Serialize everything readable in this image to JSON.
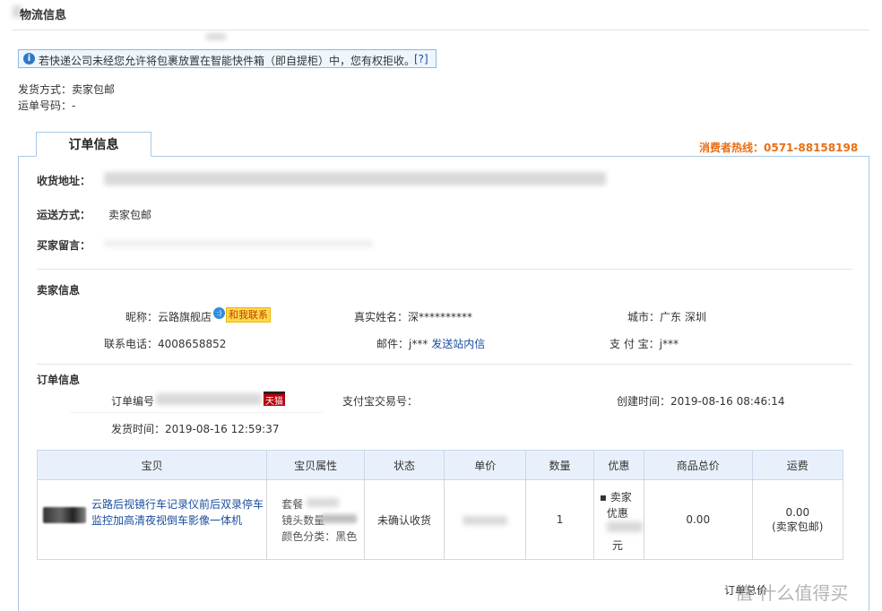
{
  "logistics": {
    "title": "物流信息",
    "notice": "若快递公司未经您允许将包裹放置在智能快件箱（即自提柜）中，您有权拒收。",
    "notice_help": "[?]",
    "ship_method_label": "发货方式：",
    "ship_method_value": "卖家包邮",
    "waybill_label": "运单号码：",
    "waybill_value": "-"
  },
  "tab": {
    "label": "订单信息"
  },
  "hotline": "消费者热线：0571-88158198",
  "receiver": {
    "address_label": "收货地址：",
    "shipping_label": "运送方式：",
    "shipping_value": "卖家包邮",
    "message_label": "买家留言："
  },
  "seller": {
    "section_title": "卖家信息",
    "nickname_label": "昵称：",
    "nickname_value": "云路旗舰店",
    "contact_badge": "和我联系",
    "realname_label": "真实姓名：",
    "realname_value": "深**********",
    "city_label": "城市：",
    "city_value": "广东 深圳",
    "phone_label": "联系电话：",
    "phone_value": "4008658852",
    "email_label": "邮件：",
    "email_value": "j***",
    "email_link": "发送站内信",
    "alipay_label": "支 付 宝：",
    "alipay_value": "j***"
  },
  "order": {
    "section_title": "订单信息",
    "order_no_label": "订单编号",
    "tmall_badge": "天猫",
    "alipay_trade_label": "支付宝交易号：",
    "created_label": "创建时间：",
    "created_value": "2019-08-16 08:46:14",
    "shipped_label": "发货时间：",
    "shipped_value": "2019-08-16 12:59:37"
  },
  "goods_table": {
    "headers": [
      "宝贝",
      "宝贝属性",
      "状态",
      "单价",
      "数量",
      "优惠",
      "商品总价",
      "运费"
    ],
    "row": {
      "title": "云路后视镜行车记录仪前后双录停车监控加高清夜视倒车影像一体机",
      "attr_package": "套餐",
      "attr_lens": "镜头数量",
      "attr_color": "颜色分类：黑色",
      "status": "未确认收货",
      "quantity": "1",
      "discount_line1": "卖家",
      "discount_line2": "优惠",
      "discount_line3": "元",
      "goods_total": "0.00",
      "freight": "0.00",
      "freight_note": "(卖家包邮)"
    }
  },
  "footer": {
    "total_prefix": "订单总价",
    "watermark": "值 什么值得买"
  }
}
